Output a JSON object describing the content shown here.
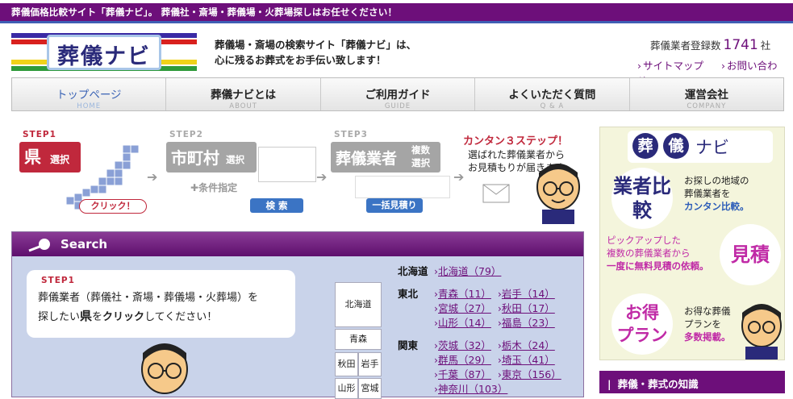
{
  "topbar": {
    "text": "葬儀価格比較サイト「葬儀ナビ」。 葬儀社・斎場・葬儀場・火葬場探しはお任せください！"
  },
  "logo": {
    "text": "葬儀ナビ"
  },
  "tagline": {
    "line1": "葬儀場・斎場の検索サイト「葬儀ナビ」は、",
    "line2": "心に残るお葬式をお手伝い致します！"
  },
  "registration": {
    "label": "葬儀業者登録数",
    "count": "1741",
    "unit": "社"
  },
  "sublinks": [
    {
      "label": "サイトマップ"
    },
    {
      "label": "お問い合わせ"
    }
  ],
  "nav": [
    {
      "jp": "トップページ",
      "en": "HOME",
      "active": true
    },
    {
      "jp": "葬儀ナビとは",
      "en": "ABOUT"
    },
    {
      "jp": "ご利用ガイド",
      "en": "GUIDE"
    },
    {
      "jp": "よくいただく質問",
      "en": "Q & A"
    },
    {
      "jp": "運営会社",
      "en": "COMPANY"
    }
  ],
  "steps": {
    "step1": {
      "no": "STEP1",
      "big": "県",
      "small": "選択",
      "click": "クリック！"
    },
    "step2": {
      "no": "STEP2",
      "big": "市町村",
      "small": "選択",
      "cond": "条件指定",
      "search": "検 索"
    },
    "step3": {
      "no": "STEP3",
      "big": "葬儀業者",
      "small1": "複数",
      "small2": "選択",
      "bulk": "一括見積り"
    },
    "final": {
      "title": "カンタン３ステップ！",
      "line1": "選ばれた葬儀業者から",
      "line2": "お見積もりが届きます。"
    }
  },
  "search": {
    "title": "Search",
    "bubble_step": "STEP1",
    "bubble_line1": "葬儀業者（葬儀社・斎場・葬儀場・火葬場）を",
    "bubble_line2a": "探したい",
    "bubble_line2b": "県",
    "bubble_line2c": "を",
    "bubble_line2d": "クリック",
    "bubble_line2e": "してください！",
    "map_buttons": [
      "北海道",
      "青森",
      "秋田",
      "岩手",
      "山形",
      "宮城"
    ],
    "regions": [
      {
        "name": "北海道",
        "prefs": [
          "北海道（79）"
        ]
      },
      {
        "name": "東北",
        "prefs": [
          "青森（11）",
          "岩手（14）"
        ]
      },
      {
        "name": "",
        "prefs": [
          "宮城（27）",
          "秋田（17）"
        ]
      },
      {
        "name": "",
        "prefs": [
          "山形（14）",
          "福島（23）"
        ]
      },
      {
        "name": "関東",
        "prefs": [
          "茨城（32）",
          "栃木（24）"
        ]
      },
      {
        "name": "",
        "prefs": [
          "群馬（29）",
          "埼玉（41）"
        ]
      },
      {
        "name": "",
        "prefs": [
          "千葉（87）",
          "東京（156）"
        ]
      },
      {
        "name": "",
        "prefs": [
          "神奈川（103）"
        ]
      }
    ]
  },
  "sidebar": {
    "logo_chars": [
      "葬",
      "儀"
    ],
    "logo_rest": "ナビ",
    "block1_title": "業者比較",
    "block1_l1": "お探しの地域の",
    "block1_l2": "葬儀業者を",
    "block1_l3": "カンタン比較。",
    "block2_l1": "ピックアップした",
    "block2_l2": "複数の葬儀業者から",
    "block2_l3": "一度に無料見積の依頼。",
    "block2_title": "見積",
    "block3_title1": "お得",
    "block3_title2": "プラン",
    "block3_l1": "お得な葬儀",
    "block3_l2": "プランを",
    "block3_l3": "多数掲載。",
    "section_title": "葬儀・葬式の知識"
  }
}
